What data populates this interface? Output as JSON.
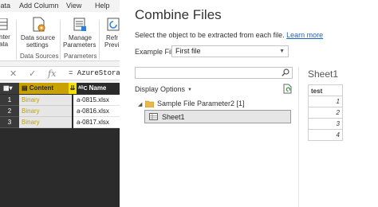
{
  "ribbon": {
    "tabs": [
      "Data",
      "Add Column",
      "View",
      "Help"
    ],
    "buttons": {
      "enter_data": [
        "nter",
        "ata"
      ],
      "data_source_settings": [
        "Data source",
        "settings"
      ],
      "manage_parameters": [
        "Manage",
        "Parameters"
      ],
      "refresh_preview": [
        "Refr",
        "Previ"
      ]
    },
    "groups": [
      "Data Sources",
      "Parameters"
    ]
  },
  "formula_bar": {
    "text": "= AzureStorage"
  },
  "grid": {
    "columns": [
      "Content",
      "Name"
    ],
    "rows": [
      {
        "num": "1",
        "content": "Binary",
        "name": "a-0815.xlsx"
      },
      {
        "num": "2",
        "content": "Binary",
        "name": "a-0816.xlsx"
      },
      {
        "num": "3",
        "content": "Binary",
        "name": "a-0817.xlsx"
      }
    ]
  },
  "dialog": {
    "title": "Combine Files",
    "description": "Select the object to be extracted from each file.",
    "learn_more": "Learn more",
    "example_file_label": "Example File:",
    "example_file_value": "First file",
    "display_options": "Display Options",
    "tree": {
      "folder": "Sample File Parameter2 [1]",
      "item": "Sheet1"
    },
    "preview": {
      "title": "Sheet1",
      "header": "test",
      "values": [
        "1",
        "2",
        "3",
        "4"
      ]
    }
  },
  "colors": {
    "content_header_bg": "#c8a200",
    "binary_text": "#c8a200",
    "link": "#1f62b8"
  }
}
